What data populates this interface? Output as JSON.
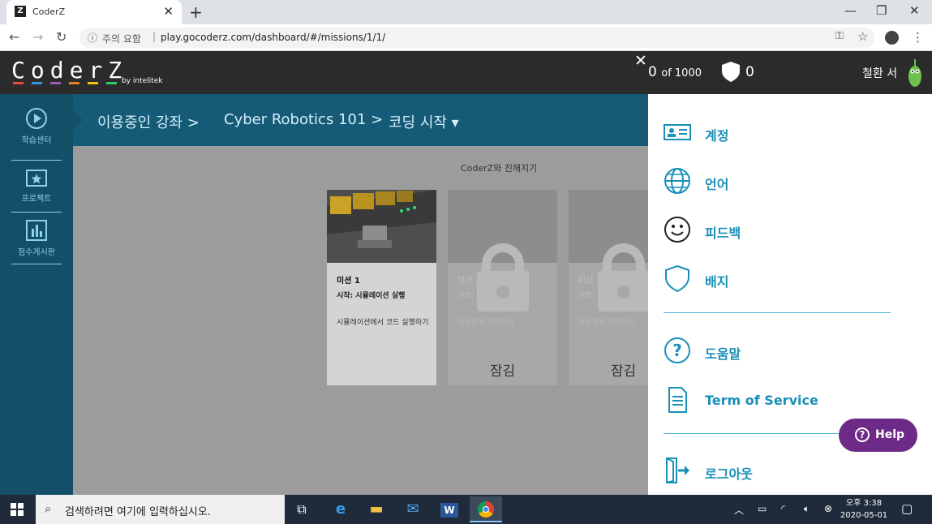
{
  "browser": {
    "tab_title": "CoderZ",
    "tab_favicon": "Z",
    "address_security": "주의 요함",
    "address_url": "play.gocoderz.com/dashboard/#/missions/1/1/"
  },
  "app": {
    "logo_text": "CoderZ",
    "logo_by": "by intelitek",
    "score_value": "0",
    "score_total": "of 1000",
    "badge_count": "0",
    "username": "철환 서"
  },
  "sidebar": {
    "items": [
      {
        "label": "학습센터",
        "icon": "play-circle-icon"
      },
      {
        "label": "프로젝트",
        "icon": "star-folder-icon"
      },
      {
        "label": "점수게시판",
        "icon": "bar-chart-icon"
      }
    ]
  },
  "breadcrumb": {
    "items": [
      "이용중인 강좌 >",
      "Cyber Robotics 101 >",
      "코딩 시작 ▾"
    ]
  },
  "content": {
    "section_title": "CoderZ와 친해지기",
    "cards": [
      {
        "title": "미션 1",
        "subtitle": "시작: 시뮬레이션 실행",
        "desc": "시뮬레이션에서 코드 실행하기",
        "locked": false
      },
      {
        "title": "미션 2",
        "subtitle": "시작: 코딩블록 변경",
        "desc": "코딩블록 변경하기",
        "locked": true,
        "lock_label": "잠김"
      },
      {
        "title": "미션 3",
        "subtitle": "시작: 코딩블록 추가",
        "desc": "코딩블록 추가하기",
        "locked": true,
        "lock_label": "잠김"
      }
    ]
  },
  "panel_menu": {
    "items": [
      {
        "label": "계정",
        "icon": "id-card-icon"
      },
      {
        "label": "언어",
        "icon": "globe-icon"
      },
      {
        "label": "피드백",
        "icon": "smiley-icon"
      },
      {
        "label": "배지",
        "icon": "shield-icon"
      },
      {
        "label": "도움말",
        "icon": "question-circle-icon"
      },
      {
        "label": "Term of Service",
        "icon": "document-icon"
      },
      {
        "label": "로그아웃",
        "icon": "logout-door-icon"
      }
    ],
    "help_button": "Help"
  },
  "taskbar": {
    "search_placeholder": "검색하려면 여기에 입력하십시오.",
    "time": "오후 3:38",
    "date": "2020-05-01"
  },
  "colors": {
    "accent": "#1a8fb8",
    "sidebar": "#134f66",
    "header": "#2b2b2b",
    "help": "#6d2a86"
  }
}
